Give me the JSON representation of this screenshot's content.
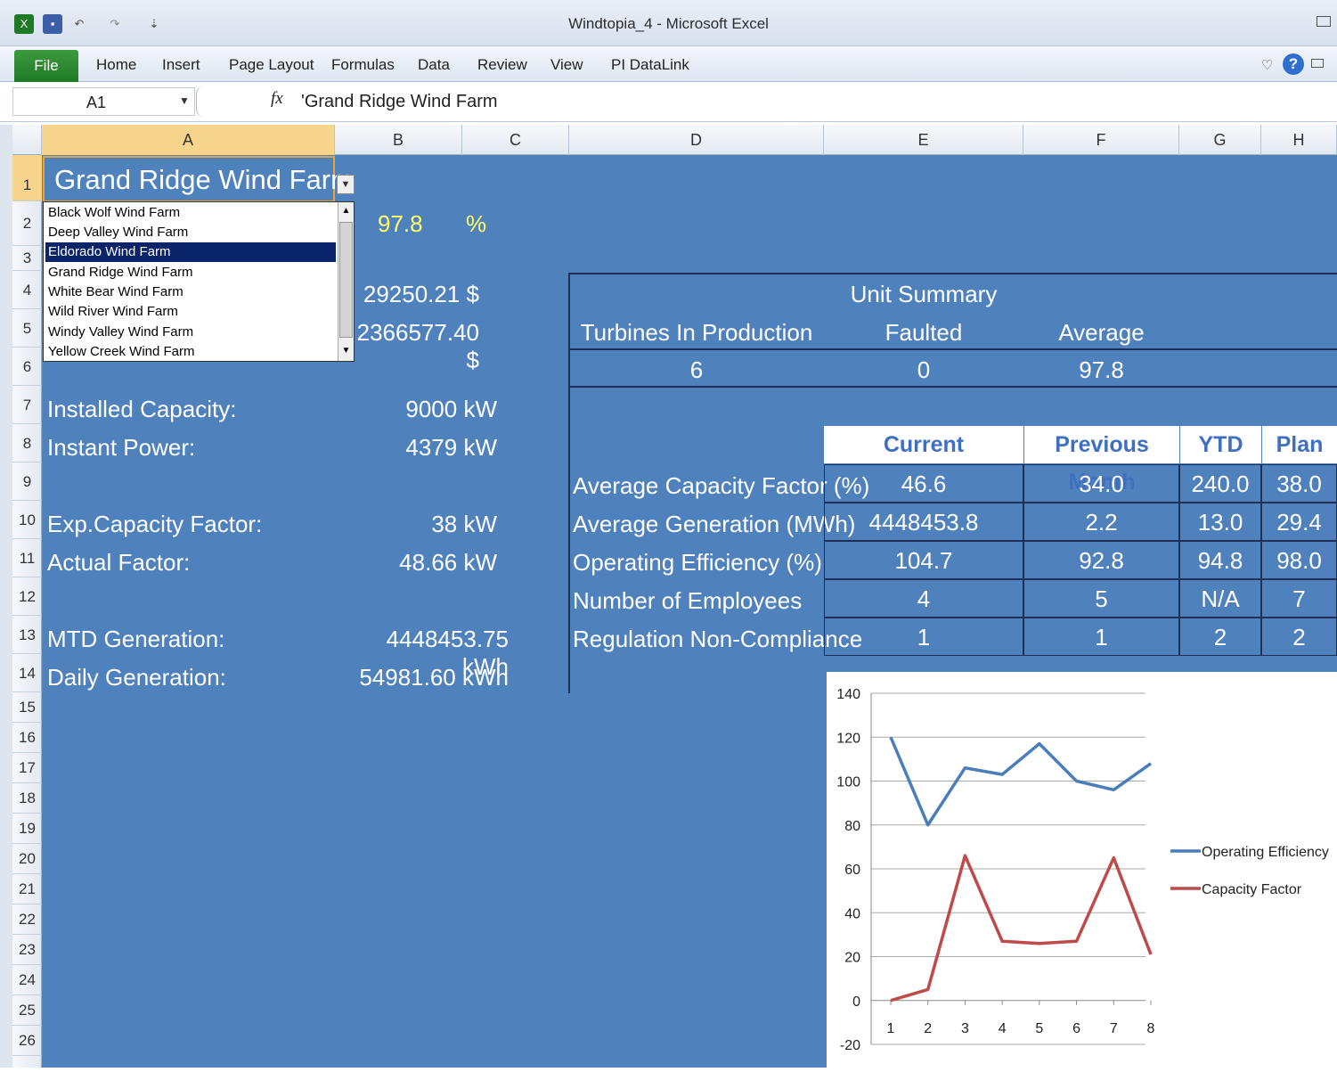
{
  "window": {
    "title": "Windtopia_4 - Microsoft Excel"
  },
  "ribbon": {
    "file": "File",
    "tabs": [
      "Home",
      "Insert",
      "Page Layout",
      "Formulas",
      "Data",
      "Review",
      "View",
      "PI DataLink"
    ]
  },
  "formula_bar": {
    "name_box": "A1",
    "fx": "fx",
    "formula": "'Grand Ridge Wind Farm"
  },
  "columns": [
    "A",
    "B",
    "C",
    "D",
    "E",
    "F",
    "G",
    "H"
  ],
  "rows": [
    "1",
    "2",
    "3",
    "4",
    "5",
    "6",
    "7",
    "8",
    "9",
    "10",
    "11",
    "12",
    "13",
    "14",
    "15",
    "16",
    "17",
    "18",
    "19",
    "20",
    "21",
    "22",
    "23",
    "24",
    "25",
    "26"
  ],
  "sheet": {
    "farm_name": "Grand Ridge Wind Farm",
    "row2_value": "97.8",
    "row2_unit": "%",
    "row4_value": "29250.21 $",
    "row5_value": "2366577.40 $",
    "installed_capacity_label": "Installed Capacity:",
    "installed_capacity_value": "9000 kW",
    "instant_power_label": "Instant Power:",
    "instant_power_value": "4379 kW",
    "exp_capacity_label": "Exp.Capacity Factor:",
    "exp_capacity_value": "38 kW",
    "actual_factor_label": "Actual Factor:",
    "actual_factor_value": "48.66 kW",
    "mtd_label": "MTD Generation:",
    "mtd_value": "4448453.75 kWh",
    "daily_label": "Daily Generation:",
    "daily_value": "54981.60 kWh"
  },
  "dropdown": {
    "items": [
      "Black Wolf Wind Farm",
      "Deep Valley Wind Farm",
      "Eldorado Wind Farm",
      "Grand Ridge Wind Farm",
      "White Bear Wind Farm",
      "Wild River Wind Farm",
      "Windy Valley Wind Farm",
      "Yellow Creek Wind Farm"
    ],
    "selected": "Eldorado Wind Farm"
  },
  "unit_summary": {
    "title": "Unit Summary",
    "headers": [
      "Turbines In Production",
      "Faulted",
      "Average"
    ],
    "values": [
      "6",
      "0",
      "97.8"
    ]
  },
  "kpi_table": {
    "headers": [
      "Current",
      "Previous Month",
      "YTD",
      "Plan"
    ],
    "rows": [
      {
        "label": "Average Capacity Factor (%)",
        "values": [
          "46.6",
          "34.0",
          "240.0",
          "38.0"
        ]
      },
      {
        "label": "Average Generation (MWh)",
        "values": [
          "4448453.8",
          "2.2",
          "13.0",
          "29.4"
        ]
      },
      {
        "label": "Operating Efficiency (%)",
        "values": [
          "104.7",
          "92.8",
          "94.8",
          "98.0"
        ]
      },
      {
        "label": "Number of Employees",
        "values": [
          "4",
          "5",
          "N/A",
          "7"
        ]
      },
      {
        "label": "Regulation Non-Compliance",
        "values": [
          "1",
          "1",
          "2",
          "2"
        ]
      }
    ]
  },
  "chart_data": {
    "type": "line",
    "x": [
      1,
      2,
      3,
      4,
      5,
      6,
      7,
      8
    ],
    "series": [
      {
        "name": "Operating Efficiency",
        "values": [
          120,
          80,
          106,
          103,
          117,
          100,
          96,
          108
        ],
        "color": "#4a7ebb"
      },
      {
        "name": "Capacity Factor",
        "values": [
          0,
          5,
          66,
          27,
          26,
          27,
          65,
          21
        ],
        "color": "#be4b48"
      }
    ],
    "ylim": [
      -20,
      140
    ],
    "yticks": [
      -20,
      0,
      20,
      40,
      60,
      80,
      100,
      120,
      140
    ],
    "grid": true,
    "legend": "right"
  }
}
